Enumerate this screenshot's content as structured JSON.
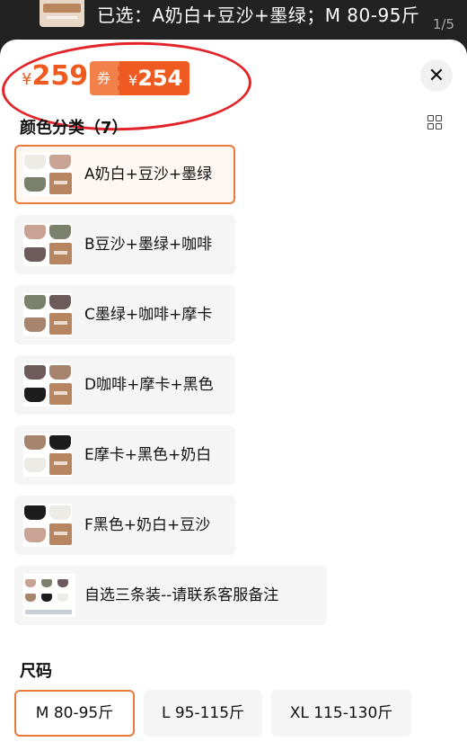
{
  "header": {
    "selected_text": "已选：A奶白+豆沙+墨绿；M 80-95斤",
    "pager": "1/5"
  },
  "price": {
    "currency": "¥",
    "original": "259",
    "coupon_tag": "券后",
    "after_coupon": "254"
  },
  "close": {
    "icon": "close-icon",
    "glyph": "✕"
  },
  "color_section": {
    "title": "颜色分类（7）",
    "view_toggle_icon": "grid-view-icon",
    "options": [
      {
        "label": "A奶白+豆沙+墨绿",
        "selected": true,
        "colors": [
          "#ecebe6",
          "#c9a394",
          "#7b806c"
        ]
      },
      {
        "label": "B豆沙+墨绿+咖啡",
        "selected": false,
        "colors": [
          "#c9a394",
          "#7b806c",
          "#6d5a5a"
        ]
      },
      {
        "label": "C墨绿+咖啡+摩卡",
        "selected": false,
        "colors": [
          "#7b806c",
          "#6d5a5a",
          "#a6846e"
        ]
      },
      {
        "label": "D咖啡+摩卡+黑色",
        "selected": false,
        "colors": [
          "#6d5a5a",
          "#a6846e",
          "#1d1d1d"
        ]
      },
      {
        "label": "E摩卡+黑色+奶白",
        "selected": false,
        "colors": [
          "#a6846e",
          "#1d1d1d",
          "#ecebe6"
        ]
      },
      {
        "label": "F黑色+奶白+豆沙",
        "selected": false,
        "colors": [
          "#1d1d1d",
          "#ecebe6",
          "#c9a394"
        ]
      },
      {
        "label": "自选三条装--请联系客服备注",
        "selected": false,
        "colors": [
          "#c9a394",
          "#7b806c",
          "#6d5a5a",
          "#a6846e",
          "#1d1d1d",
          "#ecebe6"
        ]
      }
    ]
  },
  "size_section": {
    "title": "尺码",
    "options": [
      {
        "label": "M 80-95斤",
        "selected": true
      },
      {
        "label": "L 95-115斤",
        "selected": false
      },
      {
        "label": "XL 115-130斤",
        "selected": false
      }
    ]
  },
  "colors": {
    "accent": "#ee5a20",
    "coupon_tag": "#f2804a",
    "selected_border": "#e87a3a",
    "annotation_circle": "#e2242a"
  }
}
